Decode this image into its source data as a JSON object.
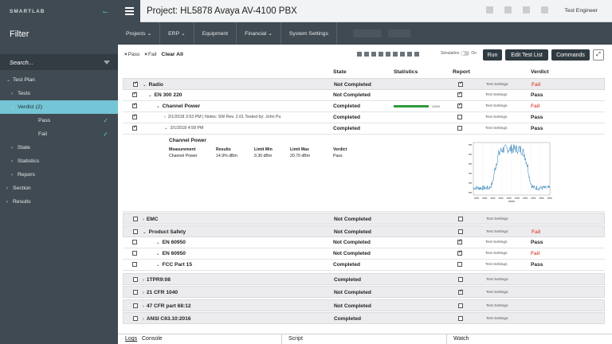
{
  "app": {
    "brand": "SMARTLAB",
    "title": "Project: HL5878 Avaya AV-4100 PBX",
    "user": "Test Engineer"
  },
  "sidebar": {
    "filter_title": "Filter",
    "search_placeholder": "Search...",
    "items": [
      {
        "label": "Test Plan",
        "chev": "⌄"
      },
      {
        "label": "Tests",
        "chev": "›"
      },
      {
        "label": "Verdict (2)",
        "chev": "⌄"
      },
      {
        "label": "Pass",
        "chev": "",
        "check": "✓"
      },
      {
        "label": "Fail",
        "chev": "",
        "check": "✓"
      },
      {
        "label": "State",
        "chev": "›"
      },
      {
        "label": "Statistics",
        "chev": "›"
      },
      {
        "label": "Repors",
        "chev": "›"
      },
      {
        "label": "Section",
        "chev": "›"
      },
      {
        "label": "Results",
        "chev": "›"
      }
    ]
  },
  "menu": [
    "Projects ⌄",
    "ERP ⌄",
    "Equipment",
    "Financial ⌄",
    "System Settings"
  ],
  "toolbar": {
    "chips": [
      "Pass",
      "Fail"
    ],
    "clear_all": "Clear All",
    "simulation": "Simulation",
    "sim_state": "On",
    "run": "Run",
    "edit": "Edit Test List",
    "commands": "Commands",
    "expand": "⤢"
  },
  "table": {
    "headers": {
      "state": "State",
      "statistics": "Statistics",
      "report": "Report",
      "verdict": "Verdict"
    },
    "rows": [
      {
        "name": "Radio",
        "arrow": "⌄",
        "cb": true,
        "state": "Not Completed",
        "rep": true,
        "ts": "Test Settings",
        "verdict": "Fail",
        "group": true
      },
      {
        "name": "EN 300 220",
        "arrow": "⌄",
        "cb": true,
        "state": "Not Completed",
        "rep": true,
        "ts": "Test Settings",
        "verdict": "Pass"
      },
      {
        "name": "Channel Power",
        "arrow": "⌄",
        "cb": true,
        "state": "Completed",
        "rep": true,
        "ts": "Test Settings",
        "verdict": "Fail",
        "progress": 1.0,
        "progress_label": "100%"
      },
      {
        "name": "2/1/2018 3:53 PM  |  Notes: SW Rev. 2.01 Tested by: John Pu",
        "arrow": "›",
        "cb": true,
        "state": "Completed",
        "rep": false,
        "ts": "Test Settings",
        "verdict": "Pass",
        "light": true
      },
      {
        "name": "3/1/2018 4:58 PM",
        "arrow": "⌄",
        "cb": true,
        "state": "Completed",
        "rep": false,
        "ts": "Test Settings",
        "verdict": "Pass",
        "light": true
      },
      {
        "name": "EMC",
        "arrow": "›",
        "cb": false,
        "state": "Not Completed",
        "rep": false,
        "ts": "Test Settings",
        "verdict": "",
        "group": true
      },
      {
        "name": "Product Safety",
        "arrow": "⌄",
        "cb": false,
        "state": "Not Completed",
        "rep": false,
        "ts": "Test Settings",
        "verdict": "Fail",
        "group": true
      },
      {
        "name": "EN 60950",
        "arrow": "⌄",
        "cb": false,
        "state": "Not Completed",
        "rep": true,
        "ts": "Test Settings",
        "verdict": "Pass"
      },
      {
        "name": "EN 60950",
        "arrow": "⌄",
        "cb": false,
        "state": "Not Completed",
        "rep": true,
        "ts": "Test Settings",
        "verdict": "Fail"
      },
      {
        "name": "FCC Part 15",
        "arrow": "⌄",
        "cb": false,
        "state": "Completed",
        "rep": false,
        "ts": "Test Settings",
        "verdict": "Pass"
      },
      {
        "name": "1TPR9:08",
        "arrow": "›",
        "cb": false,
        "state": "Completed",
        "rep": false,
        "ts": "Test Settings",
        "verdict": "",
        "group": true
      },
      {
        "name": "21 CFR 1040",
        "arrow": "›",
        "cb": false,
        "state": "Not Completed",
        "rep": true,
        "ts": "Test Settings",
        "verdict": "",
        "group": true
      },
      {
        "name": "47 CFR part 68:12",
        "arrow": "›",
        "cb": false,
        "state": "Not Completed",
        "rep": false,
        "ts": "Test Settings",
        "verdict": "",
        "group": true
      },
      {
        "name": "ANSI C63.10:2016",
        "arrow": "›",
        "cb": false,
        "state": "Completed",
        "rep": false,
        "ts": "Test Settings",
        "verdict": "",
        "group": true
      }
    ]
  },
  "detail": {
    "title": "Channel Power",
    "columns": [
      "Measurement",
      "Results",
      "Limit Min",
      "Limit Max",
      "Verdict"
    ],
    "values": [
      "Channel Power",
      "14.9% dBm",
      "9.30 dBm",
      "20.70 dBm",
      "Pass"
    ]
  },
  "bottom": {
    "logs": "Logs",
    "console": "Console",
    "script": "Script",
    "watch": "Watch"
  },
  "colors": {
    "sidebar": "#3f4a52",
    "accent": "#74c5d5",
    "fail": "#e2574c",
    "progress": "#2e9a3f",
    "chart": "#1f78b4"
  }
}
